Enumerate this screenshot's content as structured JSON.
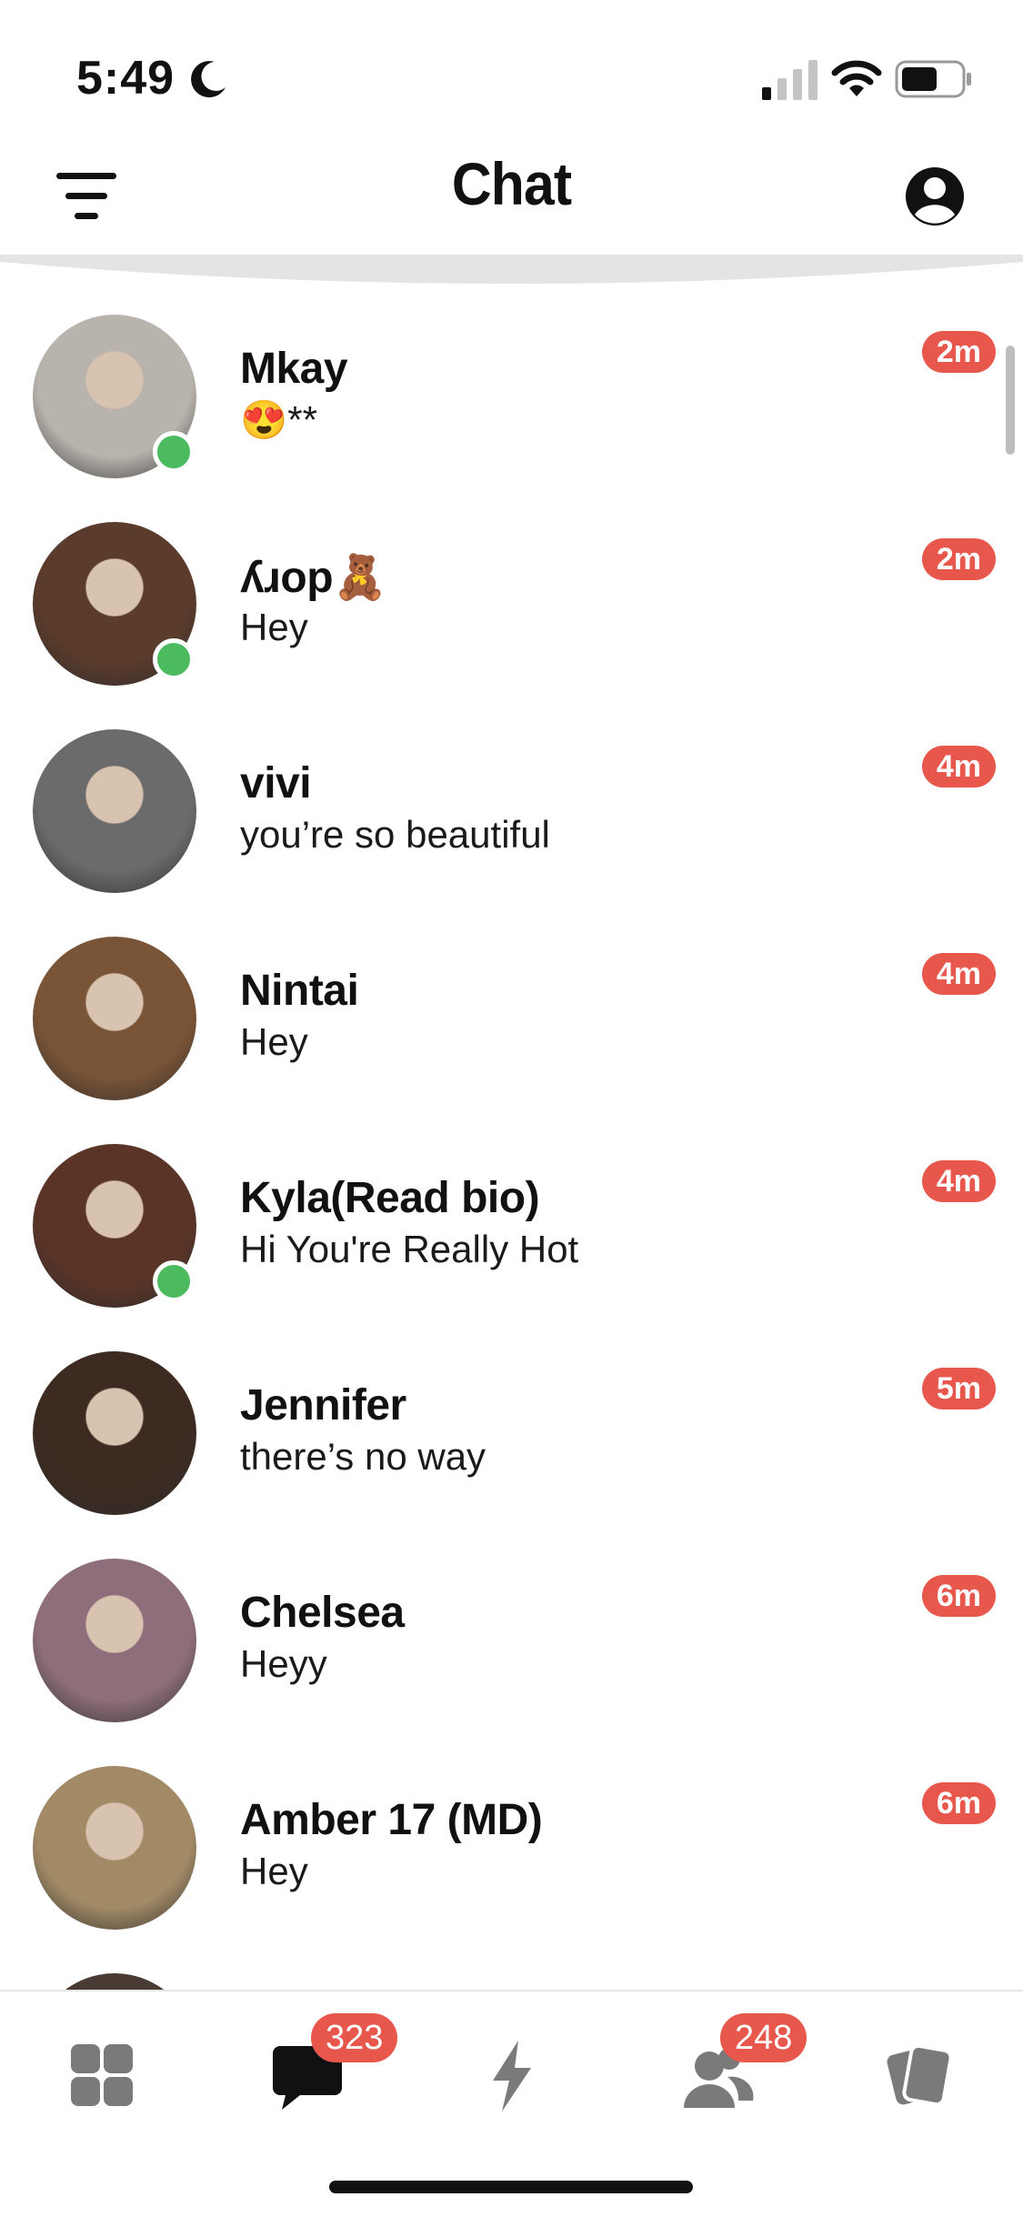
{
  "status_bar": {
    "time": "5:49"
  },
  "header": {
    "title": "Chat"
  },
  "chats": [
    {
      "name": "Mkay",
      "message": "😍**",
      "time": "2m",
      "online": true,
      "avatar_color": "#b9b3ad"
    },
    {
      "name": "ʎɹop🧸",
      "message": "Hey",
      "time": "2m",
      "online": true,
      "avatar_color": "#5a3b2c"
    },
    {
      "name": "vivi",
      "message": "you’re so beautiful",
      "time": "4m",
      "online": false,
      "avatar_color": "#6b6b6b"
    },
    {
      "name": "Nintai",
      "message": "Hey",
      "time": "4m",
      "online": false,
      "avatar_color": "#7a5436"
    },
    {
      "name": "Kyla(Read bio)",
      "message": "Hi You're Really Hot",
      "time": "4m",
      "online": true,
      "avatar_color": "#5a3427"
    },
    {
      "name": "Jennifer",
      "message": "there’s no way",
      "time": "5m",
      "online": false,
      "avatar_color": "#3d2b22"
    },
    {
      "name": "Chelsea",
      "message": "Heyy",
      "time": "6m",
      "online": false,
      "avatar_color": "#8d6e7a"
    },
    {
      "name": "Amber 17 (MD)",
      "message": "Hey",
      "time": "6m",
      "online": false,
      "avatar_color": "#a28a66"
    }
  ],
  "tab_bar": {
    "chat_badge": "323",
    "people_badge": "248"
  },
  "colors": {
    "badge": "#e8574b",
    "online": "#4cbb60",
    "icon_gray": "#7a7a7a"
  }
}
